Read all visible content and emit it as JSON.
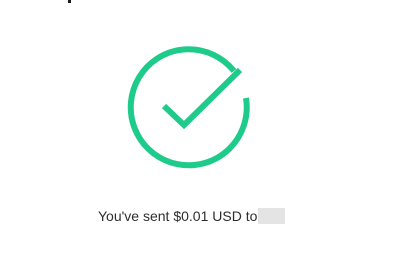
{
  "confirmation": {
    "status_icon": "check-circle-icon",
    "accent_color": "#1fcb8b",
    "message": "You've sent $0.01 USD to"
  }
}
